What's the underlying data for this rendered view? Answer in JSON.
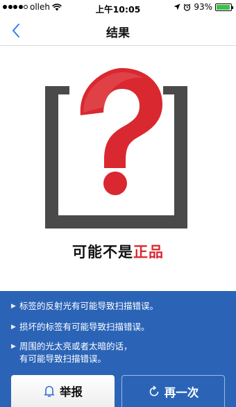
{
  "status_bar": {
    "carrier": "olleh",
    "time": "上午10:05",
    "battery_percent": "93%",
    "battery_level": 0.93
  },
  "nav": {
    "title": "结果"
  },
  "result": {
    "text_plain": "可能不是",
    "text_emphasis": "正品"
  },
  "tips": [
    {
      "lines": [
        "标签的反射光有可能导致扫描错误。"
      ]
    },
    {
      "lines": [
        "损坏的标签有可能导致扫描错误。"
      ]
    },
    {
      "lines": [
        "周围的光太亮或者太暗的话，",
        "有可能导致扫描错误。"
      ]
    }
  ],
  "buttons": {
    "report_label": "举报",
    "retry_label": "再一次"
  },
  "colors": {
    "accent_blue": "#2b64b7",
    "question_red": "#d9282f",
    "bracket_gray": "#4a4a4a",
    "battery_green": "#3cc04b"
  },
  "icons": {
    "back": "chevron-left-icon",
    "wifi": "wifi-icon",
    "location": "location-arrow-icon",
    "alarm": "alarm-icon",
    "report": "bell-icon",
    "retry": "refresh-icon"
  }
}
